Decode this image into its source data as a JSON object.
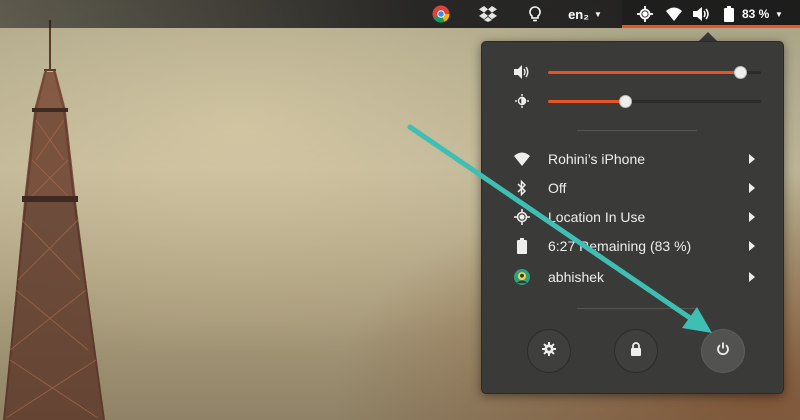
{
  "topbar": {
    "indicators": [
      {
        "icon": "chrome-icon"
      },
      {
        "icon": "dropbox-icon"
      },
      {
        "icon": "lightbulb-icon"
      }
    ],
    "language": "en₂",
    "battery_percent": "83 %"
  },
  "system_menu": {
    "volume": {
      "icon": "volume-icon",
      "level": 0.9
    },
    "brightness": {
      "icon": "brightness-icon",
      "level": 0.36
    },
    "items": [
      {
        "icon": "wifi-icon",
        "label": "Rohini’s iPhone"
      },
      {
        "icon": "bluetooth-icon",
        "label": "Off"
      },
      {
        "icon": "location-icon",
        "label": "Location In Use"
      },
      {
        "icon": "battery-icon",
        "label": "6:27 Remaining (83 %)"
      },
      {
        "icon": "user-avatar-icon",
        "label": "abhishek"
      }
    ],
    "buttons": [
      {
        "icon": "settings-icon"
      },
      {
        "icon": "lock-icon"
      },
      {
        "icon": "power-icon"
      }
    ]
  },
  "colors": {
    "accent": "#e95420",
    "menu_bg": "#3a3a38",
    "annotation_arrow": "#3fbfb3"
  }
}
